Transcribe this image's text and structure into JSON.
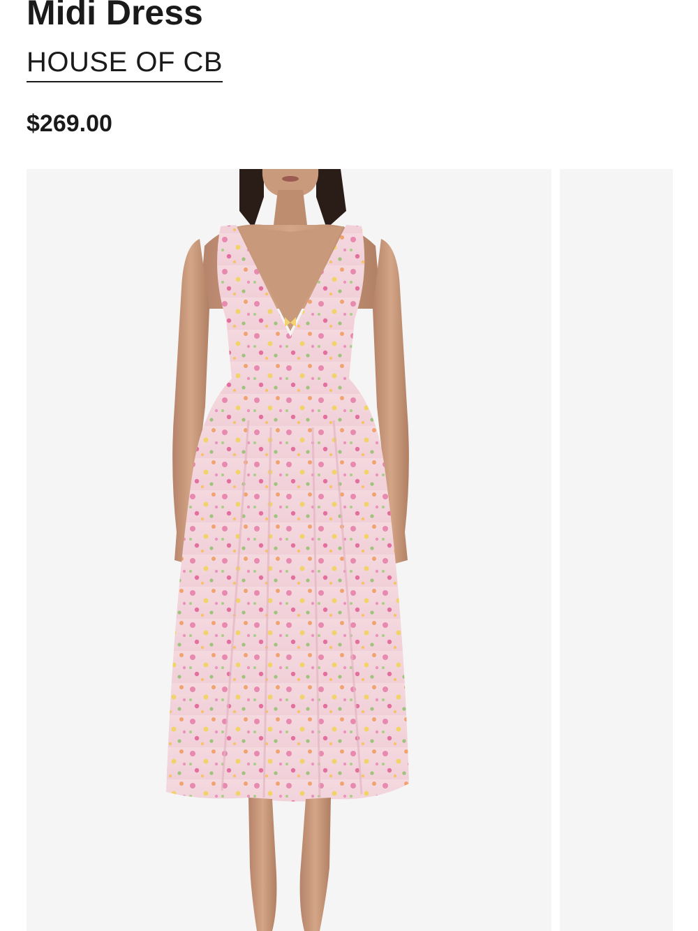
{
  "product": {
    "title": "Midi Dress",
    "brand": "HOUSE OF CB",
    "price": "$269.00"
  },
  "gallery": {
    "main_image_icon": "floral-pink-midi-dress-photo",
    "next_image_icon": "next-product-photo-peek",
    "background_color": "#f5f5f5"
  },
  "colors": {
    "text": "#1a1a1a",
    "dress_base": "#f3d6dc",
    "skin": "#c99a7c"
  }
}
